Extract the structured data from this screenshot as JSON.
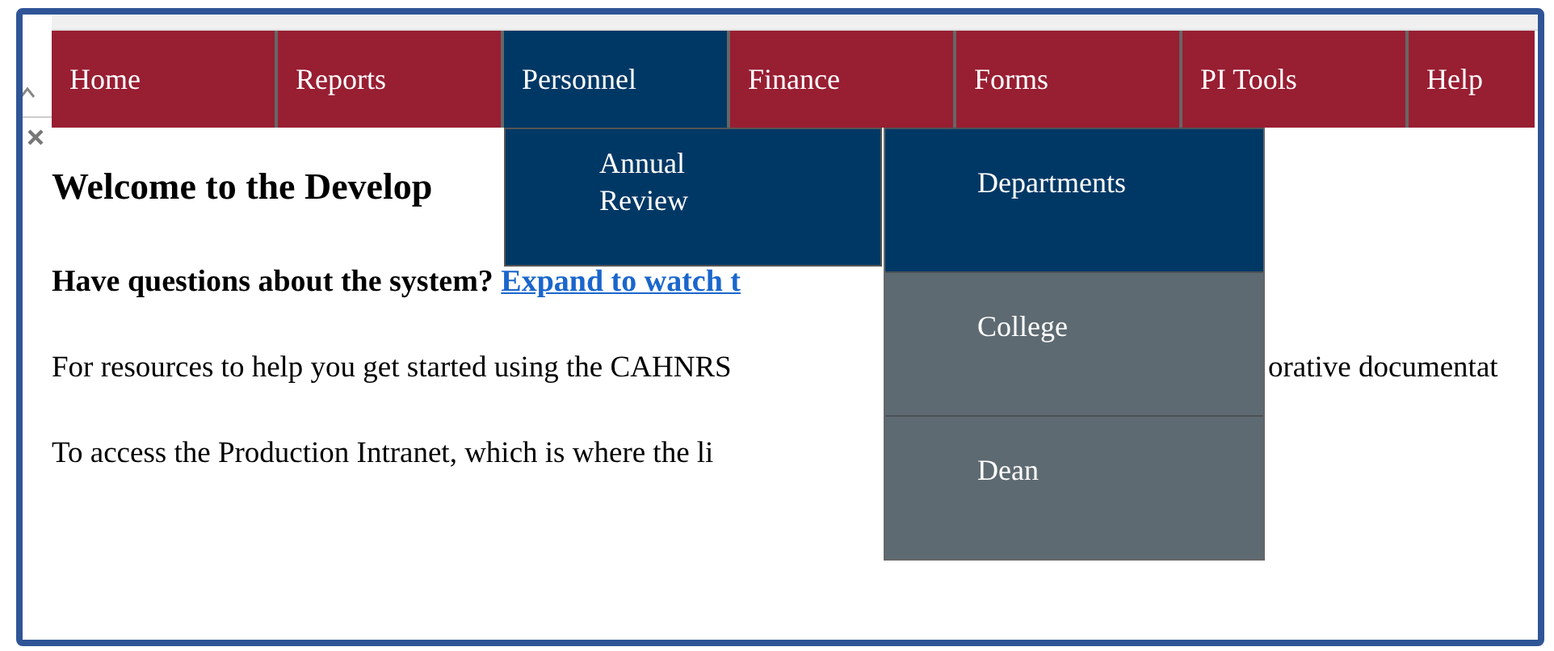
{
  "nav": [
    {
      "label": "Home",
      "selected": false
    },
    {
      "label": "Reports",
      "selected": false
    },
    {
      "label": "Personnel",
      "selected": true
    },
    {
      "label": "Finance",
      "selected": false
    },
    {
      "label": "Forms",
      "selected": false
    },
    {
      "label": "PI Tools",
      "selected": false
    },
    {
      "label": "Help",
      "selected": false
    }
  ],
  "submenu": [
    {
      "label": "Annual Review",
      "selected": true
    }
  ],
  "flyout": [
    {
      "label": "Departments",
      "selected": true
    },
    {
      "label": "College",
      "selected": false
    },
    {
      "label": "Dean",
      "selected": false
    }
  ],
  "content": {
    "heading": "Welcome to the Develop",
    "question": "Have questions about the system?",
    "link": "Expand to watch t",
    "resources_left": "For resources to help you get started using the CAHNRS",
    "resources_right": "orative documentat",
    "access": "To access the Production Intranet, which is where the li"
  }
}
